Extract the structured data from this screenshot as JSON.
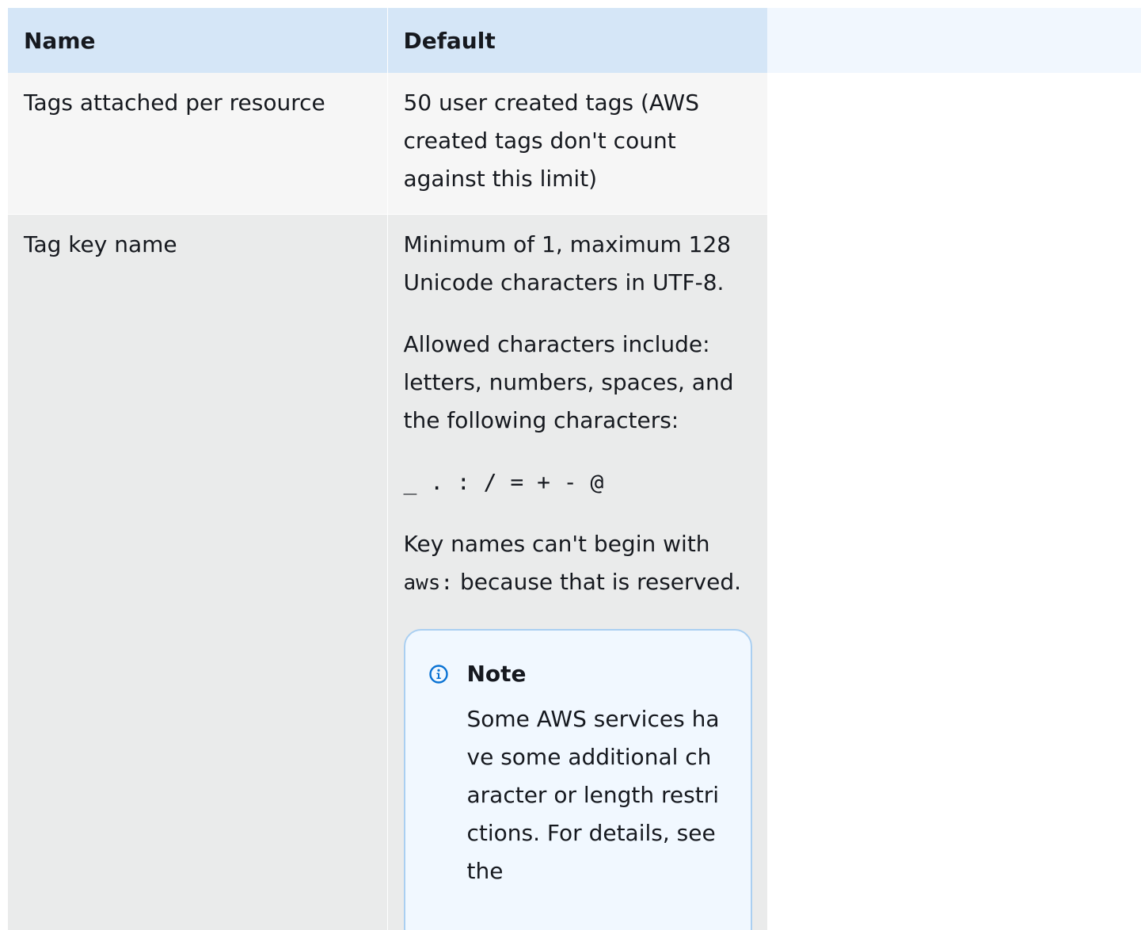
{
  "table": {
    "headers": [
      "Name",
      "Default"
    ],
    "rows": [
      {
        "name": "Tags attached per resource",
        "default": "50 user created tags (AWS created tags don't count against this limit)"
      },
      {
        "name": "Tag key name",
        "default_para1": "Minimum of 1, maximum 128 Unicode characters in UTF-8.",
        "default_para2": "Allowed characters include: letters, numbers, spaces, and the following characters:",
        "special_chars": "_ . : / = + - @",
        "key_prefix_before": "Key names can't begin with ",
        "key_prefix_code": "aws:",
        "key_prefix_after": " because that is reserved.",
        "note": {
          "title": "Note",
          "icon": "info-icon",
          "body": "Some AWS services have some additional character or length restrictions. For details, see the"
        }
      }
    ]
  },
  "colors": {
    "header_bg": "#d5e6f7",
    "row1_bg": "#f6f6f6",
    "row2_bg": "#eaebeb",
    "note_bg": "#f1f8ff",
    "note_border": "#aacff1",
    "info_icon": "#0972d3"
  }
}
